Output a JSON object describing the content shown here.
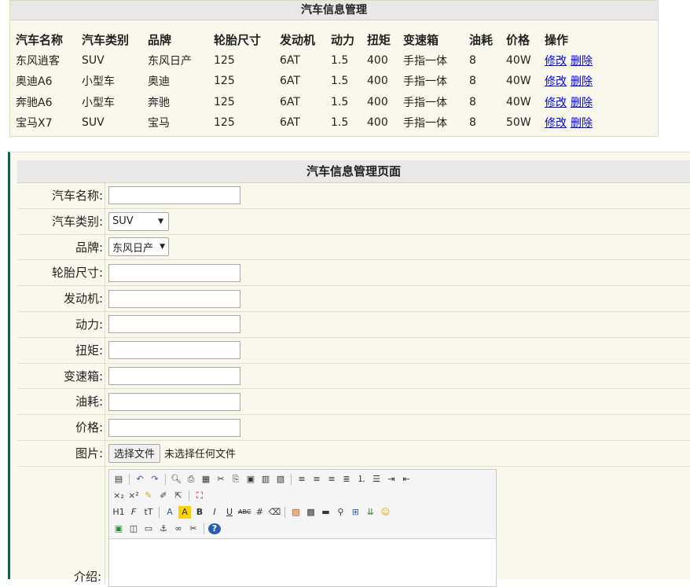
{
  "list": {
    "title": "汽车信息管理",
    "headers": [
      "汽车名称",
      "汽车类别",
      "品牌",
      "轮胎尺寸",
      "发动机",
      "动力",
      "扭矩",
      "变速箱",
      "油耗",
      "价格",
      "操作"
    ],
    "rows": [
      [
        "东风逍客",
        "SUV",
        "东风日产",
        "125",
        "6AT",
        "1.5",
        "400",
        "手指一体",
        "8",
        "40W"
      ],
      [
        "奥迪A6",
        "小型车",
        "奥迪",
        "125",
        "6AT",
        "1.5",
        "400",
        "手指一体",
        "8",
        "40W"
      ],
      [
        "奔驰A6",
        "小型车",
        "奔驰",
        "125",
        "6AT",
        "1.5",
        "400",
        "手指一体",
        "8",
        "40W"
      ],
      [
        "宝马X7",
        "SUV",
        "宝马",
        "125",
        "6AT",
        "1.5",
        "400",
        "手指一体",
        "8",
        "50W"
      ]
    ],
    "edit_label": "修改",
    "delete_label": "删除"
  },
  "form": {
    "title": "汽车信息管理页面",
    "name_label": "汽车名称:",
    "type_label": "汽车类别:",
    "type_value": "SUV",
    "brand_label": "品牌:",
    "brand_value": "东风日产",
    "tire_label": "轮胎尺寸:",
    "engine_label": "发动机:",
    "power_label": "动力:",
    "torque_label": "扭矩:",
    "gearbox_label": "变速箱:",
    "fuel_label": "油耗:",
    "price_label": "价格:",
    "image_label": "图片:",
    "file_button": "选择文件",
    "file_status": "未选择任何文件",
    "intro_label": "介绍:"
  },
  "editor": {
    "heading_label": "H1",
    "font_family_label": "F",
    "font_size_label": "tT",
    "font_color_label": "A",
    "bg_color_label": "A",
    "bold_label": "B",
    "italic_label": "I",
    "underline_label": "U",
    "strike_label": "ABC",
    "help_label": "?"
  },
  "colors": {
    "panel_bg": "#f8f8ec",
    "title_bg": "#e8e8e8",
    "link": "#0000ee",
    "accent_border": "#1d5a4a"
  }
}
